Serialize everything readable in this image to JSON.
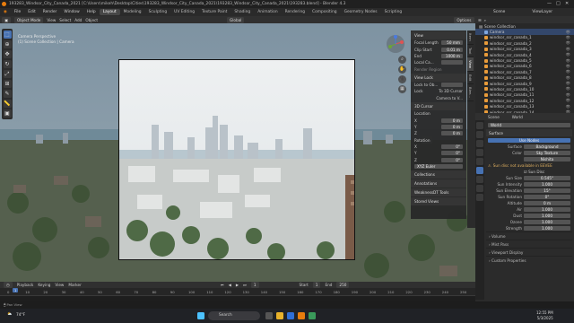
{
  "titlebar": {
    "title": "193283_Windsor_City_Canada_2021 [C:\\Users\\mikeh\\Desktop\\Cities\\193283_Windsor_City_Canada_2021\\193283_Windsor_City_Canada_2021\\193283.blend] - Blender 4.3"
  },
  "menubar": {
    "menus": [
      "File",
      "Edit",
      "Render",
      "Window",
      "Help"
    ],
    "workspaces": [
      "Layout",
      "Modeling",
      "Sculpting",
      "UV Editing",
      "Texture Paint",
      "Shading",
      "Animation",
      "Rendering",
      "Compositing",
      "Geometry Nodes",
      "Scripting"
    ],
    "scene_label": "Scene",
    "viewlayer_label": "ViewLayer"
  },
  "header3d": {
    "mode": "Object Mode",
    "menus": [
      "View",
      "Select",
      "Add",
      "Object"
    ],
    "orientation": "Global",
    "options": "Options"
  },
  "viewport_info": {
    "line1": "Camera Perspective",
    "line2": "(1) Scene Collection | Camera"
  },
  "npanel": {
    "view_section": "View",
    "focal_label": "Focal Length",
    "focal_value": "50 mm",
    "clip_start_label": "Clip Start",
    "clip_start_value": "0.01 m",
    "clip_end_label": "End",
    "clip_end_value": "1000 m",
    "local_camera_label": "Local Ca...",
    "render_region": "Render Region",
    "view_lock_section": "View Lock",
    "lock_to_object": "Lock to Ob...",
    "lock_label": "Lock",
    "to3d_cursor": "To 3D Cursor",
    "camera_to_view": "Camera to V...",
    "cursor_section": "3D Cursor",
    "location_label": "Location",
    "loc": [
      {
        "axis": "X",
        "value": "0 m"
      },
      {
        "axis": "Y",
        "value": "0 m"
      },
      {
        "axis": "Z",
        "value": "0 m"
      }
    ],
    "rotation_label": "Rotation",
    "rot": [
      {
        "axis": "X",
        "value": "0°"
      },
      {
        "axis": "Y",
        "value": "0°"
      },
      {
        "axis": "Z",
        "value": "0°"
      }
    ],
    "rot_mode": "XYZ Euler",
    "collections_section": "Collections",
    "annotations_section": "Annotations",
    "weaknessdt": "WeaknessDT Tools",
    "stored_views": "Stored Views",
    "tabs": [
      "Item",
      "Tool",
      "View",
      "Edit",
      "Blen..."
    ]
  },
  "timeline": {
    "menus": [
      "Playback",
      "Keying",
      "View",
      "Marker"
    ],
    "current_frame": "1",
    "start_label": "Start",
    "start": "1",
    "end_label": "End",
    "end": "250",
    "ticks": [
      "0",
      "10",
      "20",
      "30",
      "40",
      "50",
      "60",
      "70",
      "80",
      "90",
      "100",
      "110",
      "120",
      "130",
      "140",
      "150",
      "160",
      "170",
      "180",
      "190",
      "200",
      "210",
      "220",
      "230",
      "240",
      "250"
    ]
  },
  "statusbar": {
    "text": "Pan View"
  },
  "taskbar": {
    "search_placeholder": "Search",
    "time": "12:55 PM",
    "date": "5/3/2025",
    "weather": "74°F"
  },
  "outliner": {
    "title": "Scene Collection",
    "items": [
      {
        "name": "Camera",
        "selected": true
      },
      {
        "name": "windsor_ssr_canada_1",
        "selected": false
      },
      {
        "name": "windsor_ssr_canada_2",
        "selected": false
      },
      {
        "name": "windsor_ssr_canada_3",
        "selected": false
      },
      {
        "name": "windsor_ssr_canada_4",
        "selected": false
      },
      {
        "name": "windsor_ssr_canada_5",
        "selected": false
      },
      {
        "name": "windsor_ssr_canada_6",
        "selected": false
      },
      {
        "name": "windsor_ssr_canada_7",
        "selected": false
      },
      {
        "name": "windsor_ssr_canada_8",
        "selected": false
      },
      {
        "name": "windsor_ssr_canada_9",
        "selected": false
      },
      {
        "name": "windsor_ssr_canada_10",
        "selected": false
      },
      {
        "name": "windsor_ssr_canada_11",
        "selected": false
      },
      {
        "name": "windsor_ssr_canada_12",
        "selected": false
      },
      {
        "name": "windsor_ssr_canada_13",
        "selected": false
      },
      {
        "name": "windsor_ssr_canada_14",
        "selected": false
      }
    ]
  },
  "properties": {
    "header_scene": "Scene",
    "header_world": "World",
    "world_name": "World",
    "surface_section": "Surface",
    "use_nodes": "Use Nodes",
    "surface_label": "Surface",
    "surface_value": "Background",
    "color_label": "Color",
    "color_value": "Sky Texture",
    "sky_type": "Nishita",
    "warning": "Sun disc not available in EEVEE",
    "sun_disc": "Sun Disc",
    "rows": [
      {
        "label": "Sun Size",
        "value": "0.545°"
      },
      {
        "label": "Sun Intensity",
        "value": "1.000"
      },
      {
        "label": "Sun Elevation",
        "value": "15°"
      },
      {
        "label": "Sun Rotation",
        "value": "0°"
      },
      {
        "label": "Altitude",
        "value": "0 m"
      },
      {
        "label": "Air",
        "value": "1.000"
      },
      {
        "label": "Dust",
        "value": "1.000"
      },
      {
        "label": "Ozone",
        "value": "1.000"
      },
      {
        "label": "Strength",
        "value": "1.000"
      }
    ],
    "collapsed": [
      "Volume",
      "Mist Pass",
      "Viewport Display",
      "Custom Properties"
    ]
  }
}
